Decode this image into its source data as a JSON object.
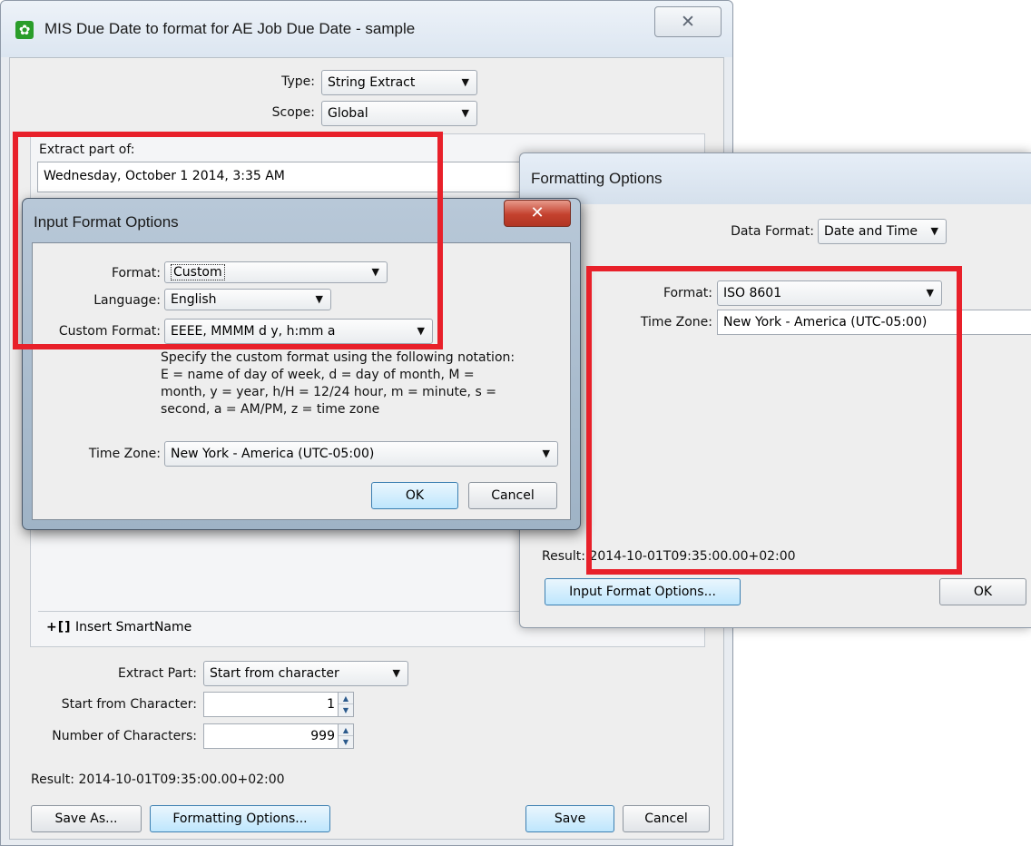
{
  "main_window": {
    "title": "MIS Due Date to format for AE Job Due Date - sample",
    "close_glyph": "✕",
    "type_label": "Type:",
    "type_value": "String Extract",
    "scope_label": "Scope:",
    "scope_value": "Global",
    "extract_label": "Extract part of:",
    "extract_value": "Wednesday, October 1 2014, 3:35 AM",
    "insert_smartname": "Insert SmartName",
    "insert_smartname_icon": "+[]",
    "extract_part_label": "Extract Part:",
    "extract_part_value": "Start from character",
    "start_char_label": "Start from Character:",
    "start_char_value": "1",
    "num_chars_label": "Number of Characters:",
    "num_chars_value": "999",
    "result_label": "Result:",
    "result_value": "2014-10-01T09:35:00.00+02:00",
    "buttons": {
      "save_as": "Save As...",
      "formatting_options": "Formatting Options...",
      "save": "Save",
      "cancel": "Cancel"
    }
  },
  "formatting_dialog": {
    "title": "Formatting Options",
    "data_format_label": "Data Format:",
    "data_format_value": "Date and Time",
    "format_label": "Format:",
    "format_value": "ISO 8601",
    "timezone_label": "Time Zone:",
    "timezone_value": "New York - America (UTC-05:00)",
    "result_label": "Result:",
    "result_value": "2014-10-01T09:35:00.00+02:00",
    "buttons": {
      "input_format_options": "Input Format Options...",
      "ok": "OK"
    }
  },
  "input_format_dialog": {
    "title": "Input Format Options",
    "close_glyph": "✕",
    "format_label": "Format:",
    "format_value": "Custom",
    "language_label": "Language:",
    "language_value": "English",
    "custom_format_label": "Custom Format:",
    "custom_format_value": "EEEE, MMMM d y, h:mm a",
    "help_lines": [
      "Specify the custom format using the following notation:",
      "E = name of day of week, d = day of month, M =",
      "month, y = year, h/H = 12/24 hour, m = minute, s =",
      "second, a = AM/PM, z = time zone"
    ],
    "timezone_label": "Time Zone:",
    "timezone_value": "New York - America (UTC-05:00)",
    "buttons": {
      "ok": "OK",
      "cancel": "Cancel"
    }
  },
  "colors": {
    "annotation": "#e8202a",
    "accent_button": "#bee6fd",
    "app_icon": "#2a9d2a"
  },
  "icons": {
    "app": "gear-icon",
    "dropdown": "triangle-down-icon",
    "spinner": "spinner-arrows-icon",
    "close": "close-icon"
  }
}
